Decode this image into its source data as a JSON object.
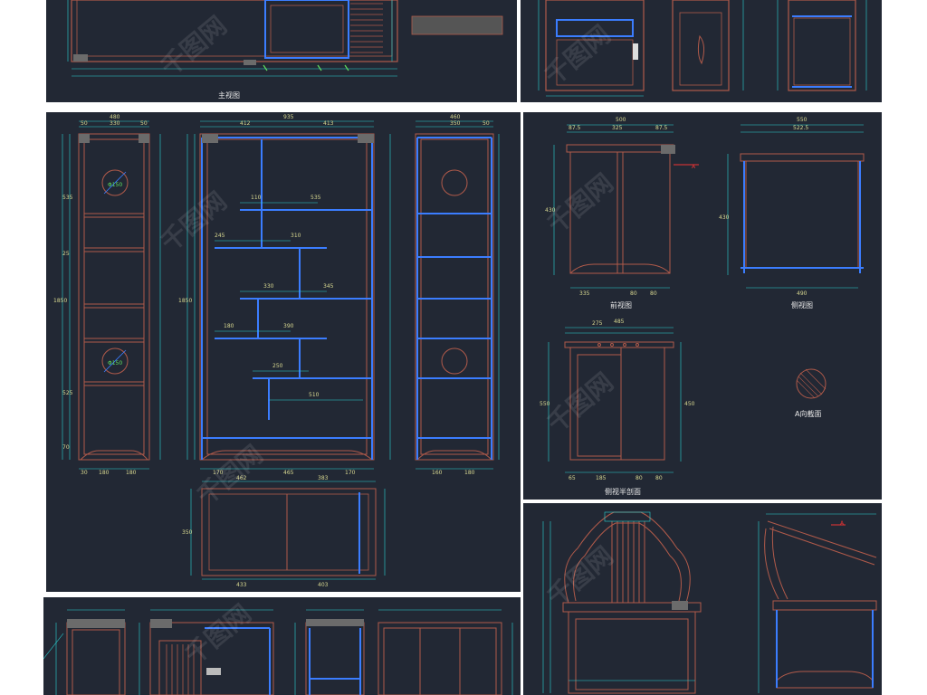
{
  "panels": {
    "top_left": {
      "caption": "主视图"
    },
    "top_right": {},
    "bookcase": {
      "top_dims": [
        "480",
        "330",
        "50",
        "50",
        "935",
        "412",
        "413",
        "460",
        "350",
        "50"
      ],
      "left_dims": [
        "1850",
        "535",
        "525",
        "25",
        "70"
      ],
      "mid_dims": [
        "110",
        "535",
        "245",
        "310",
        "330",
        "345",
        "180",
        "390",
        "250",
        "510",
        "170",
        "465",
        "170"
      ],
      "bottom_dims": [
        "30",
        "180",
        "180",
        "160",
        "180"
      ],
      "plan_dims": [
        "462",
        "383",
        "433",
        "403",
        "350"
      ],
      "circle_label": "Φ150"
    },
    "chair_views": {
      "front_caption": "前视图",
      "side_caption": "侧视图",
      "section_caption": "侧视半剖面",
      "detail_caption": "A向截面",
      "detail_marker": "A",
      "front_dims": [
        "500",
        "87.5",
        "325",
        "87.5",
        "430",
        "335",
        "80",
        "80"
      ],
      "side_dims": [
        "550",
        "522.5",
        "430",
        "490"
      ],
      "section_dims": [
        "275",
        "485",
        "550",
        "450",
        "65",
        "185",
        "80",
        "80"
      ]
    },
    "armchair": {
      "marker": "A"
    },
    "bottom_cabinet": {}
  },
  "watermark": "千图网",
  "colors": {
    "background": "#222834",
    "red_line": "#b05a4a",
    "blue_line": "#3b7dff",
    "dim_line": "#2ad4d4",
    "dim_text": "#d8d890"
  }
}
